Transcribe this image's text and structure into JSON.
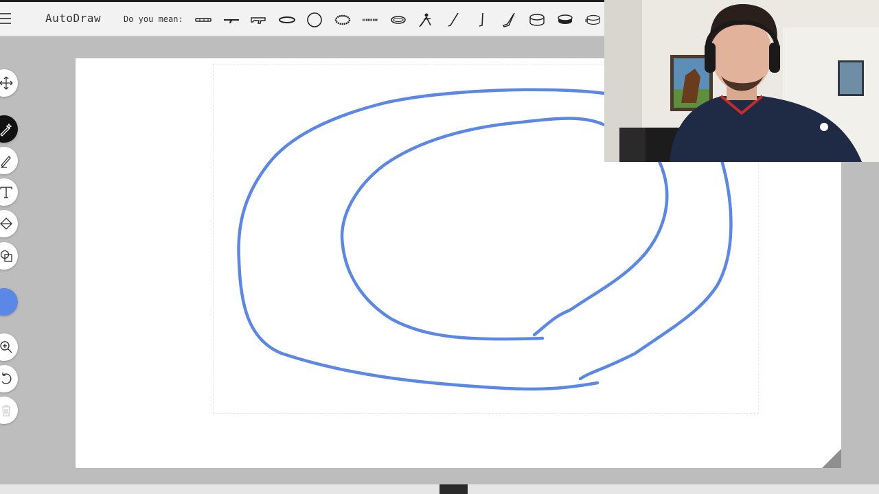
{
  "app": {
    "title": "AutoDraw",
    "suggestion_label": "Do you mean:"
  },
  "suggestions": [
    {
      "icon": "bullet-row-icon"
    },
    {
      "icon": "rifle-icon"
    },
    {
      "icon": "gun-icon"
    },
    {
      "icon": "flat-ellipse-icon"
    },
    {
      "icon": "circle-icon"
    },
    {
      "icon": "beaded-ring-icon"
    },
    {
      "icon": "dash-line-icon"
    },
    {
      "icon": "ring-icon"
    },
    {
      "icon": "hockey-player-icon"
    },
    {
      "icon": "stick-icon"
    },
    {
      "icon": "hook-stick-icon"
    },
    {
      "icon": "hockey-stick-icon"
    },
    {
      "icon": "cylinder-icon"
    },
    {
      "icon": "hockey-puck-icon"
    },
    {
      "icon": "stacked-discs-icon"
    }
  ],
  "tools": [
    {
      "name": "select-tool",
      "icon": "move-icon"
    },
    {
      "name": "autodraw-tool",
      "icon": "autodraw-pen-icon",
      "active": true
    },
    {
      "name": "draw-tool",
      "icon": "pencil-icon"
    },
    {
      "name": "type-tool",
      "icon": "text-icon"
    },
    {
      "name": "fill-tool",
      "icon": "fill-bucket-icon"
    },
    {
      "name": "shape-tool",
      "icon": "shapes-icon"
    },
    {
      "name": "color-tool",
      "icon": "color-swatch",
      "color": "#5b87e6"
    },
    {
      "name": "zoom-tool",
      "icon": "zoom-in-icon"
    },
    {
      "name": "undo-tool",
      "icon": "undo-icon"
    },
    {
      "name": "delete-tool",
      "icon": "trash-icon",
      "disabled": true
    }
  ],
  "colors": {
    "stroke": "#5b87e6",
    "header_bg": "#f2f2f2",
    "workspace_bg": "#bdbdbd"
  }
}
